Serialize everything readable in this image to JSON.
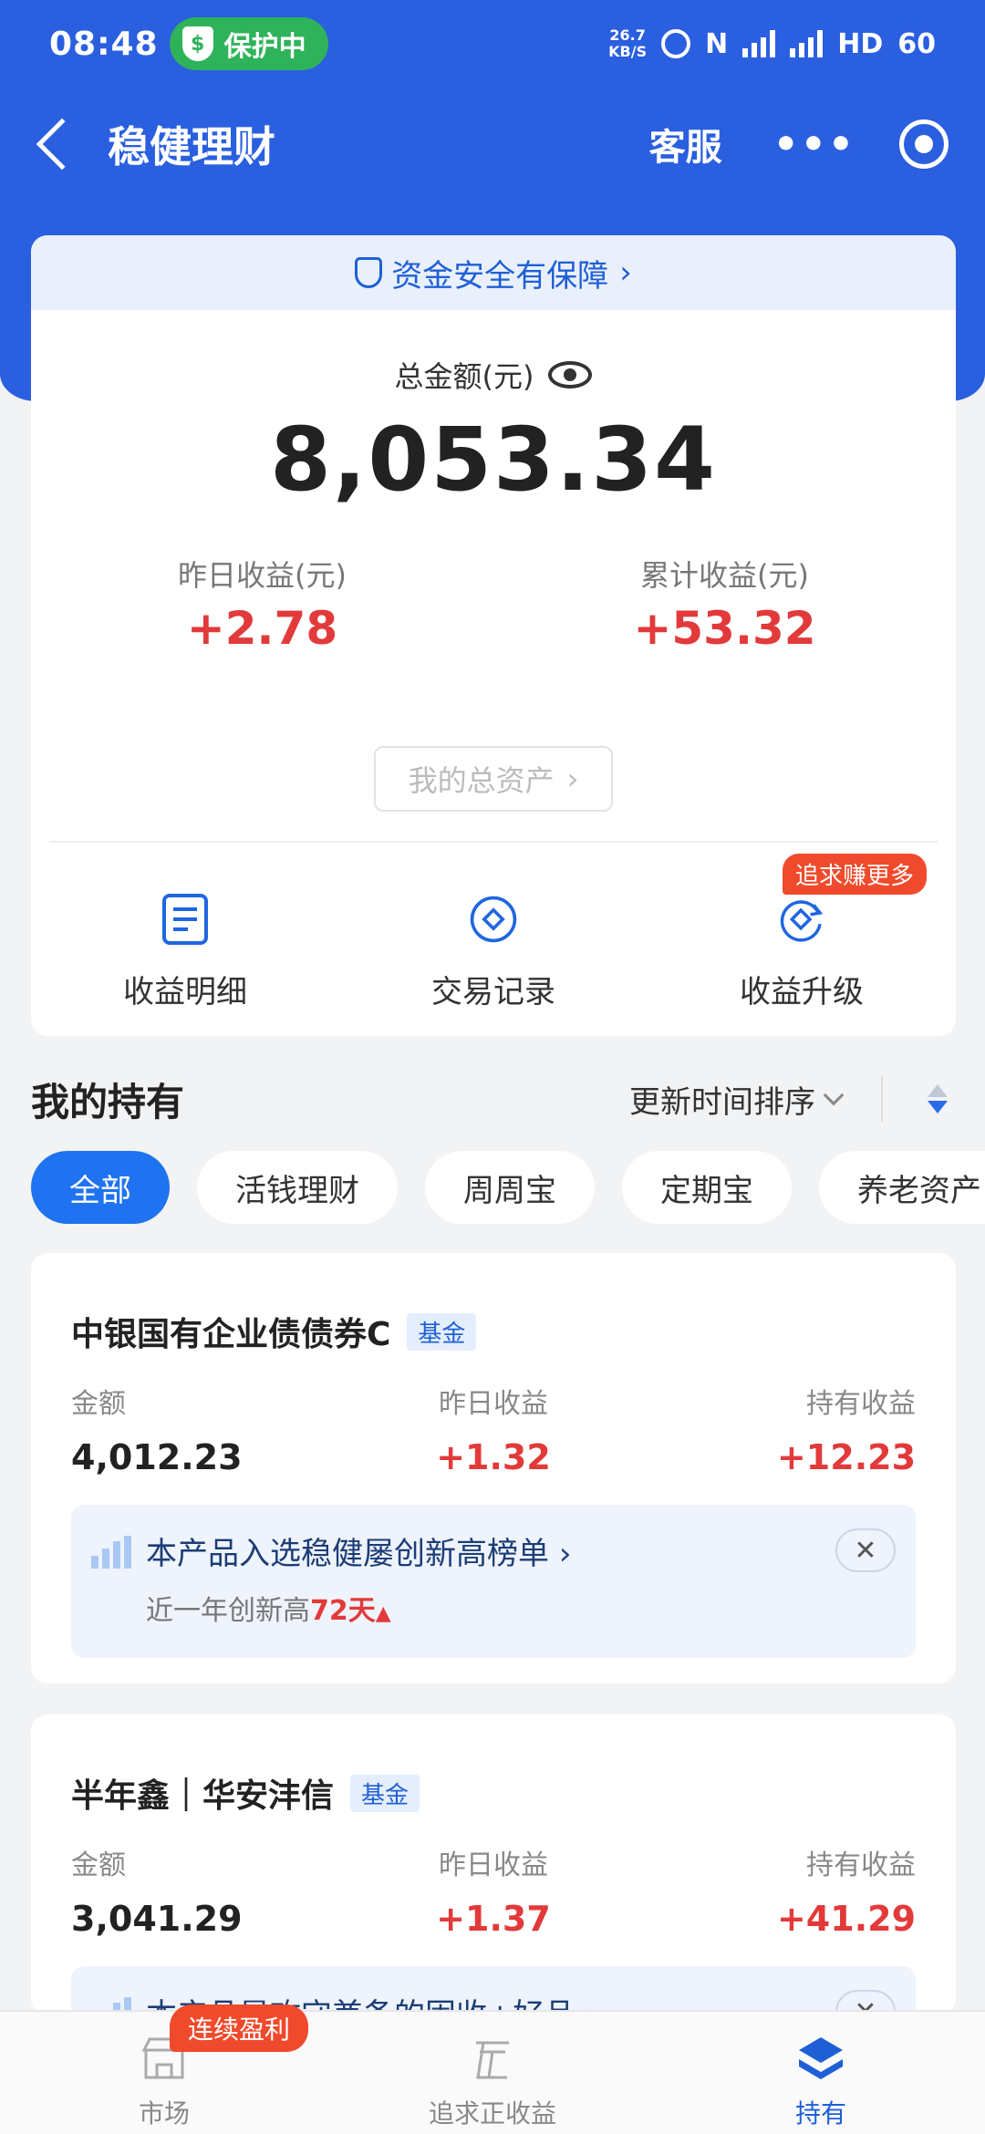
{
  "status_bar": {
    "time": "08:48",
    "protect_label": "保护中",
    "speed": "26.7",
    "speed_unit": "KB/S",
    "hd_label": "HD",
    "battery": "60"
  },
  "nav": {
    "title": "稳健理财",
    "service_label": "客服",
    "more_label": "•••"
  },
  "summary": {
    "safety_text": "资金安全有保障",
    "total_label": "总金额(元)",
    "total_value": "8,053.34",
    "yesterday_label": "昨日收益(元)",
    "yesterday_value": "+2.78",
    "cumulative_label": "累计收益(元)",
    "cumulative_value": "+53.32",
    "assets_button": "我的总资产",
    "actions": [
      {
        "label": "收益明细"
      },
      {
        "label": "交易记录"
      },
      {
        "label": "收益升级"
      }
    ],
    "upgrade_badge": "追求赚更多"
  },
  "holdings": {
    "title": "我的持有",
    "sort_label": "更新时间排序",
    "chips": [
      "全部",
      "活钱理财",
      "周周宝",
      "定期宝",
      "养老资产"
    ],
    "col_amount": "金额",
    "col_yesterday": "昨日收益",
    "col_holding": "持有收益",
    "items": [
      {
        "name": "中银国有企业债债券C",
        "tag": "基金",
        "amount": "4,012.23",
        "yesterday": "+1.32",
        "holding": "+12.23",
        "promo_title": "本产品入选稳健屡创新高榜单",
        "promo_sub": "近一年创新高",
        "promo_days": "72天"
      },
      {
        "name": "半年鑫｜华安沣信",
        "tag": "基金",
        "amount": "3,041.29",
        "yesterday": "+1.37",
        "holding": "+41.29",
        "promo_title": "本产品是攻守兼备的固收+好品"
      }
    ]
  },
  "tabbar": {
    "tabs": [
      {
        "label": "市场"
      },
      {
        "label": "追求正收益"
      },
      {
        "label": "持有"
      }
    ],
    "streak_badge": "连续盈利"
  },
  "colors": {
    "brand_blue": "#2a5fe0",
    "gain_red": "#e23a3a",
    "chip_active": "#1f73f0"
  }
}
